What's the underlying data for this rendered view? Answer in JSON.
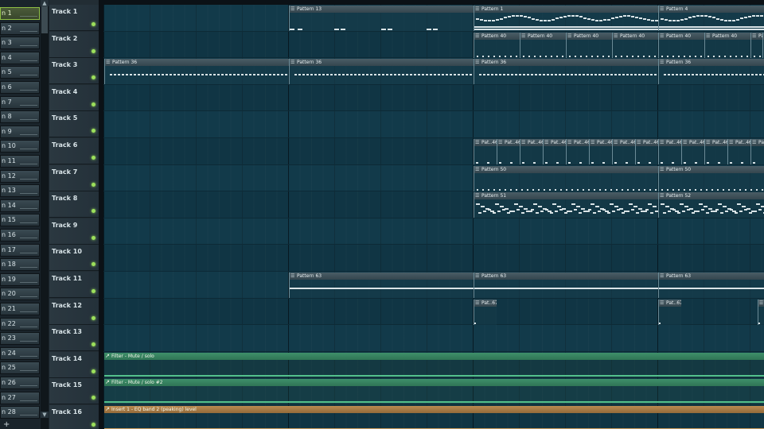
{
  "picker": {
    "items": [
      {
        "label": "n 1",
        "selected": true
      },
      {
        "label": "n 2"
      },
      {
        "label": "n 3"
      },
      {
        "label": "n 4"
      },
      {
        "label": "n 5"
      },
      {
        "label": "n 6"
      },
      {
        "label": "n 7"
      },
      {
        "label": "n 8"
      },
      {
        "label": "n 9"
      },
      {
        "label": "n 10"
      },
      {
        "label": "n 11"
      },
      {
        "label": "n 12"
      },
      {
        "label": "n 13"
      },
      {
        "label": "n 14"
      },
      {
        "label": "n 15"
      },
      {
        "label": "n 16"
      },
      {
        "label": "n 17"
      },
      {
        "label": "n 18"
      },
      {
        "label": "n 19"
      },
      {
        "label": "n 20"
      },
      {
        "label": "n 21"
      },
      {
        "label": "n 22"
      },
      {
        "label": "n 23"
      },
      {
        "label": "n 24"
      },
      {
        "label": "n 25"
      },
      {
        "label": "n 26"
      },
      {
        "label": "n 27"
      },
      {
        "label": "n 28"
      }
    ],
    "add_icon": "plus-icon",
    "add_symbol": "+"
  },
  "tracks": [
    {
      "name": "Track 1"
    },
    {
      "name": "Track 2"
    },
    {
      "name": "Track 3"
    },
    {
      "name": "Track 4"
    },
    {
      "name": "Track 5"
    },
    {
      "name": "Track 6"
    },
    {
      "name": "Track 7"
    },
    {
      "name": "Track 8"
    },
    {
      "name": "Track 9"
    },
    {
      "name": "Track 10"
    },
    {
      "name": "Track 11"
    },
    {
      "name": "Track 12"
    },
    {
      "name": "Track 13"
    },
    {
      "name": "Track 14"
    },
    {
      "name": "Track 15"
    },
    {
      "name": "Track 16"
    }
  ],
  "clips": [
    {
      "track": 0,
      "label": "Pattern 13",
      "start": 8,
      "len": 8,
      "kind": "pattern13"
    },
    {
      "track": 0,
      "label": "Pattern 1",
      "start": 16,
      "len": 8,
      "kind": "melody"
    },
    {
      "track": 0,
      "label": "Pattern 4",
      "start": 24,
      "len": 5,
      "kind": "melody"
    },
    {
      "track": 1,
      "label": "Pattern 40",
      "start": 16,
      "len": 2,
      "kind": "dots"
    },
    {
      "track": 1,
      "label": "Pattern 40",
      "start": 18,
      "len": 2,
      "kind": "dots"
    },
    {
      "track": 1,
      "label": "Pattern 40",
      "start": 20,
      "len": 2,
      "kind": "dots"
    },
    {
      "track": 1,
      "label": "Pattern 40",
      "start": 22,
      "len": 2,
      "kind": "dots"
    },
    {
      "track": 1,
      "label": "Pattern 40",
      "start": 24,
      "len": 2,
      "kind": "dots"
    },
    {
      "track": 1,
      "label": "Pattern 40",
      "start": 26,
      "len": 2,
      "kind": "dots"
    },
    {
      "track": 1,
      "label": "Pa",
      "start": 28,
      "len": 0.5,
      "kind": "dots"
    },
    {
      "track": 1,
      "label": "P",
      "start": 28.5,
      "len": 0.5,
      "kind": "dots"
    },
    {
      "track": 2,
      "label": "Pattern 36",
      "start": 0,
      "len": 8,
      "kind": "dense"
    },
    {
      "track": 2,
      "label": "Pattern 36",
      "start": 8,
      "len": 8,
      "kind": "dense"
    },
    {
      "track": 2,
      "label": "Pattern 36",
      "start": 16,
      "len": 8,
      "kind": "dense"
    },
    {
      "track": 2,
      "label": "Pattern 36",
      "start": 24,
      "len": 5,
      "kind": "dense"
    },
    {
      "track": 5,
      "label": "Pat..46",
      "start": 16,
      "len": 1,
      "kind": "sparse"
    },
    {
      "track": 5,
      "label": "Pat..46",
      "start": 17,
      "len": 1,
      "kind": "sparse"
    },
    {
      "track": 5,
      "label": "Pat..46",
      "start": 18,
      "len": 1,
      "kind": "sparse"
    },
    {
      "track": 5,
      "label": "Pat..46",
      "start": 19,
      "len": 1,
      "kind": "sparse"
    },
    {
      "track": 5,
      "label": "Pat..46",
      "start": 20,
      "len": 1,
      "kind": "sparse"
    },
    {
      "track": 5,
      "label": "Pat..46",
      "start": 21,
      "len": 1,
      "kind": "sparse"
    },
    {
      "track": 5,
      "label": "Pat..46",
      "start": 22,
      "len": 1,
      "kind": "sparse"
    },
    {
      "track": 5,
      "label": "Pat..46",
      "start": 23,
      "len": 1,
      "kind": "sparse"
    },
    {
      "track": 5,
      "label": "Pat..46",
      "start": 24,
      "len": 1,
      "kind": "sparse"
    },
    {
      "track": 5,
      "label": "Pat..46",
      "start": 25,
      "len": 1,
      "kind": "sparse"
    },
    {
      "track": 5,
      "label": "Pat..46",
      "start": 26,
      "len": 1,
      "kind": "sparse"
    },
    {
      "track": 5,
      "label": "Pat..46",
      "start": 27,
      "len": 1,
      "kind": "sparse"
    },
    {
      "track": 5,
      "label": "Pat..46",
      "start": 28,
      "len": 1,
      "kind": "sparse"
    },
    {
      "track": 6,
      "label": "Pattern 50",
      "start": 16,
      "len": 8,
      "kind": "dots"
    },
    {
      "track": 6,
      "label": "Pattern 50",
      "start": 24,
      "len": 5,
      "kind": "dots"
    },
    {
      "track": 7,
      "label": "Pattern 51",
      "start": 16,
      "len": 8,
      "kind": "arp"
    },
    {
      "track": 7,
      "label": "Pattern 52",
      "start": 24,
      "len": 5,
      "kind": "arp"
    },
    {
      "track": 10,
      "label": "Pattern 63",
      "start": 8,
      "len": 8,
      "kind": "line"
    },
    {
      "track": 10,
      "label": "Pattern 63",
      "start": 16,
      "len": 8,
      "kind": "line"
    },
    {
      "track": 10,
      "label": "Pattern 63",
      "start": 24,
      "len": 5,
      "kind": "line"
    },
    {
      "track": 11,
      "label": "Pat..67",
      "start": 16,
      "len": 1,
      "kind": "empty"
    },
    {
      "track": 11,
      "label": "Pat..67",
      "start": 24,
      "len": 1,
      "kind": "empty"
    },
    {
      "track": 11,
      "label": "P",
      "start": 28.3,
      "len": 0.7,
      "kind": "empty"
    }
  ],
  "automation": [
    {
      "track": 13,
      "label": "Filter - Mute / solo",
      "color": "green",
      "line_color": "#53c08b"
    },
    {
      "track": 14,
      "label": "Filter - Mute / solo #2",
      "color": "green",
      "line_color": "#53c08b"
    },
    {
      "track": 15,
      "label": "Insert 1 - EQ band 2 (peaking) level",
      "color": "orange",
      "line_color": "#c79a5d"
    }
  ]
}
